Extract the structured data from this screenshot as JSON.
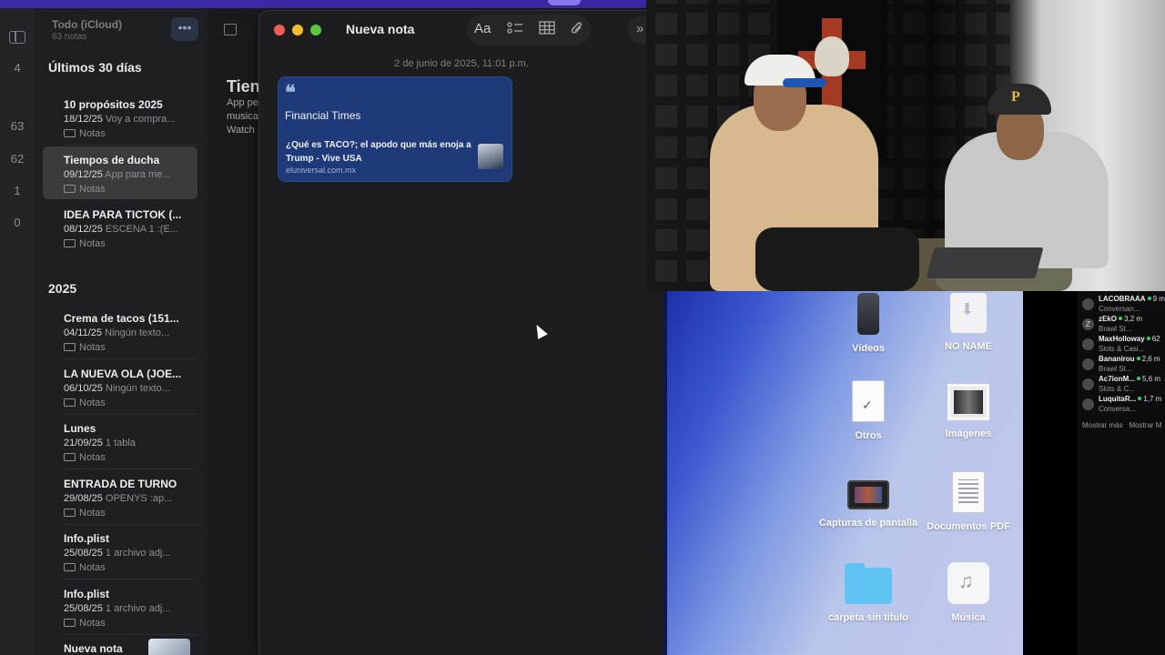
{
  "sidebar": {
    "folder_counts": [
      "4",
      "63",
      "62",
      "1",
      "0"
    ]
  },
  "note_list": {
    "header_title": "Todo (iCloud)",
    "header_count": "63 notas",
    "more_glyph": "•••",
    "sections": [
      {
        "title": "Últimos 30 días",
        "notes": [
          {
            "title": "10 propósitos 2025",
            "date": "18/12/25",
            "preview": "Voy a compra...",
            "folder": "Notas"
          },
          {
            "title": "Tiempos de ducha",
            "date": "09/12/25",
            "preview": "App para me...",
            "folder": "Notas"
          },
          {
            "title": "IDEA PARA TICTOK (...",
            "date": "08/12/25",
            "preview": "ESCENA 1 :(E...",
            "folder": "Notas"
          }
        ]
      },
      {
        "title": "2025",
        "notes": [
          {
            "title": "Crema de tacos (151...",
            "date": "04/11/25",
            "preview": "Ningún texto...",
            "folder": "Notas"
          },
          {
            "title": "LA NUEVA OLA (JOE...",
            "date": "06/10/25",
            "preview": "Ningún texto...",
            "folder": "Notas"
          },
          {
            "title": "Lunes",
            "date": "21/09/25",
            "preview": "1 tabla",
            "folder": "Notas"
          },
          {
            "title": "ENTRADA DE TURNO",
            "date": "29/08/25",
            "preview": "OPENYS :ap...",
            "folder": "Notas"
          },
          {
            "title": "Info.plist",
            "date": "25/08/25",
            "preview": "1 archivo adj...",
            "folder": "Notas"
          },
          {
            "title": "Info.plist",
            "date": "25/08/25",
            "preview": "1 archivo adj...",
            "folder": "Notas"
          },
          {
            "title": "Nueva nota",
            "date": "",
            "preview": "",
            "folder": ""
          }
        ]
      }
    ]
  },
  "editor_bg": {
    "title": "Tien",
    "lines": [
      "App pe",
      "musica",
      "Watch"
    ]
  },
  "note_window": {
    "title": "Nueva nota",
    "format_label": "Aa",
    "date_stamp": "2 de junio de 2025, 11:01 p.m.",
    "link_card": {
      "quote_glyph": "❝",
      "source": "Financial Times",
      "headline": "¿Qué es TACO?; el apodo que más enoja a Trump  - Vive USA",
      "domain": "eluniversal.com.mx"
    },
    "toolbar_icons": [
      "text-format-icon",
      "checklist-icon",
      "table-icon",
      "attachment-icon",
      "chevron-right-icon"
    ]
  },
  "file_picker": {
    "items": [
      {
        "label": "Vídeos",
        "icon": "phone"
      },
      {
        "label": "NO NAME",
        "icon": "dl"
      },
      {
        "label": "Otros",
        "icon": "doc"
      },
      {
        "label": "Imágenes",
        "icon": "photo"
      },
      {
        "label": "Capturas de pantalla",
        "icon": "shot"
      },
      {
        "label": "Documentos PDF",
        "icon": "pdf"
      },
      {
        "label": "carpeta sin título",
        "icon": "folder"
      },
      {
        "label": "Música",
        "icon": "music"
      }
    ]
  },
  "stream_chat": {
    "channels": [
      {
        "name": "LACOBRAAA",
        "viewers": "9 m",
        "game": "Conversan..."
      },
      {
        "name": "zEkO",
        "viewers": "3,2 m",
        "game": "Brawl St..."
      },
      {
        "name": "MaxHolloway",
        "viewers": "62",
        "game": "Slots & Casi..."
      },
      {
        "name": "Bananirou",
        "viewers": "2,6 m",
        "game": "Brawl St..."
      },
      {
        "name": "Ac7ionM...",
        "viewers": "5,6 m",
        "game": "Slots & C..."
      },
      {
        "name": "LuquitaR...",
        "viewers": "1,7 m",
        "game": "Conversa..."
      }
    ],
    "show_more": "Mostrar más",
    "show_more_2": "Mostrar M"
  }
}
